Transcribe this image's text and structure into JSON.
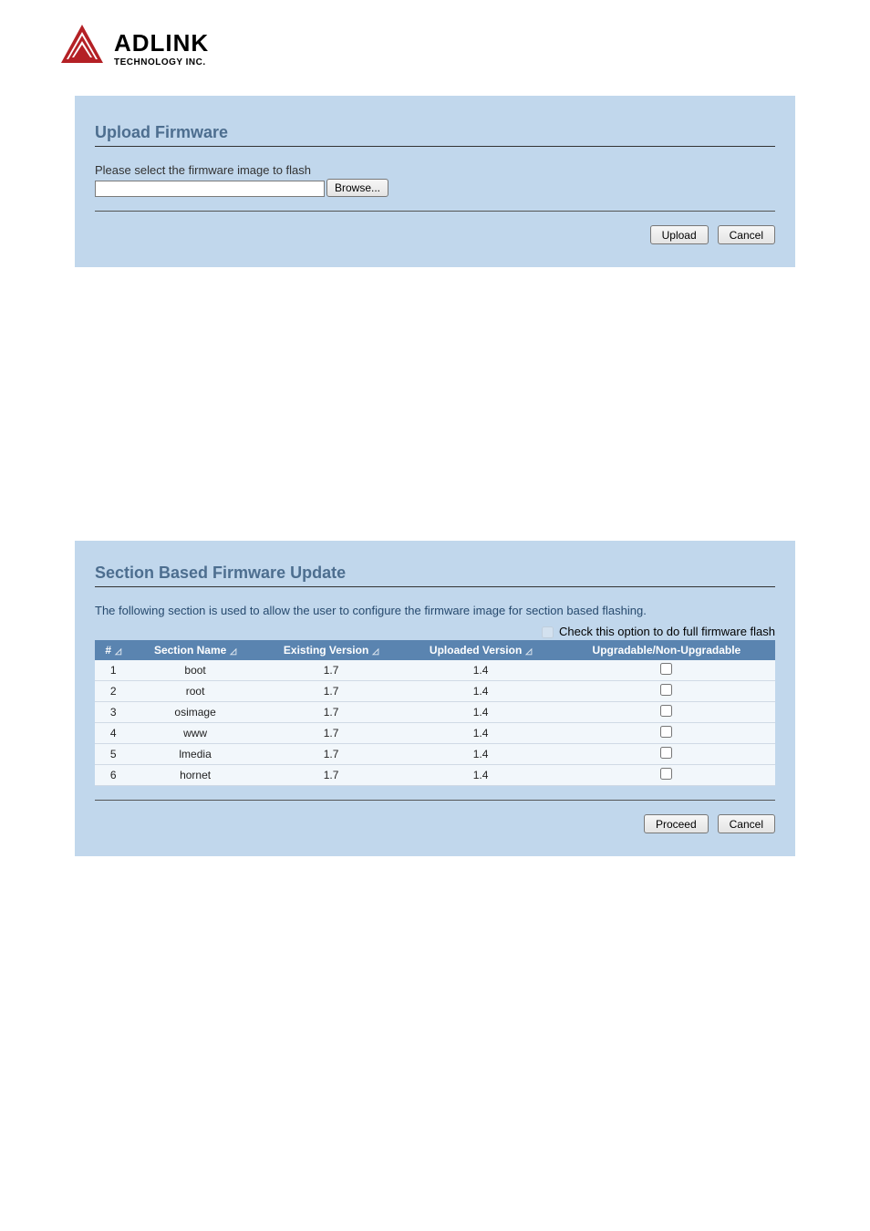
{
  "logo": {
    "brand": "ADLINK",
    "tagline": "TECHNOLOGY INC."
  },
  "upload_panel": {
    "title": "Upload Firmware",
    "prompt": "Please select the firmware image to flash",
    "browse_label": "Browse...",
    "upload_label": "Upload",
    "cancel_label": "Cancel"
  },
  "section_panel": {
    "title": "Section Based Firmware Update",
    "desc": "The following section is used to allow the user to configure the firmware image for section based flashing.",
    "full_flash_label": "Check this option to do full firmware flash",
    "proceed_label": "Proceed",
    "cancel_label": "Cancel",
    "columns": {
      "num": "#",
      "section_name": "Section Name",
      "existing_version": "Existing Version",
      "uploaded_version": "Uploaded Version",
      "upgradable": "Upgradable/Non-Upgradable"
    },
    "rows": [
      {
        "num": "1",
        "name": "boot",
        "existing": "1.7",
        "uploaded": "1.4"
      },
      {
        "num": "2",
        "name": "root",
        "existing": "1.7",
        "uploaded": "1.4"
      },
      {
        "num": "3",
        "name": "osimage",
        "existing": "1.7",
        "uploaded": "1.4"
      },
      {
        "num": "4",
        "name": "www",
        "existing": "1.7",
        "uploaded": "1.4"
      },
      {
        "num": "5",
        "name": "lmedia",
        "existing": "1.7",
        "uploaded": "1.4"
      },
      {
        "num": "6",
        "name": "hornet",
        "existing": "1.7",
        "uploaded": "1.4"
      }
    ]
  }
}
